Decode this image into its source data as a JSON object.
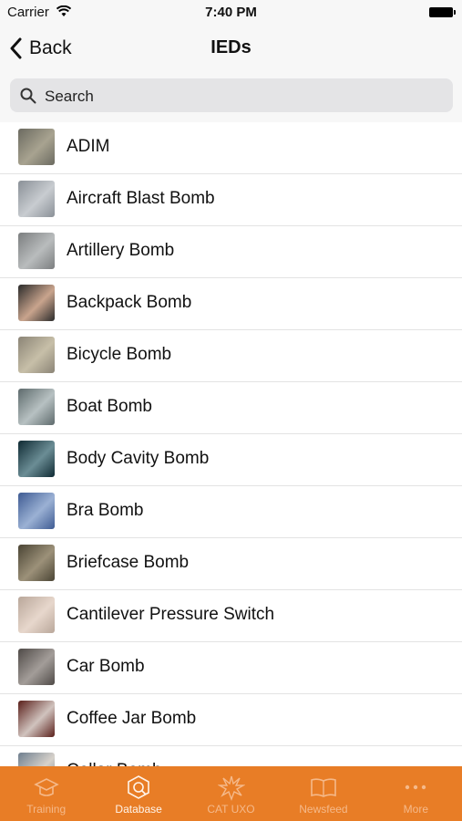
{
  "status": {
    "carrier": "Carrier",
    "time": "7:40 PM"
  },
  "nav": {
    "back_label": "Back",
    "title": "IEDs"
  },
  "search": {
    "placeholder": "Search",
    "value": ""
  },
  "items": [
    {
      "label": "ADIM",
      "thumb": [
        "#6b6a60",
        "#a8a390"
      ]
    },
    {
      "label": "Aircraft Blast Bomb",
      "thumb": [
        "#8a9097",
        "#c8ccd0"
      ]
    },
    {
      "label": "Artillery Bomb",
      "thumb": [
        "#7b7e7f",
        "#b9bcbd"
      ]
    },
    {
      "label": "Backpack Bomb",
      "thumb": [
        "#2a2a2a",
        "#c9a48d"
      ]
    },
    {
      "label": "Bicycle Bomb",
      "thumb": [
        "#8b8476",
        "#c7bfa8"
      ]
    },
    {
      "label": "Boat Bomb",
      "thumb": [
        "#5e6a6c",
        "#b7c1c2"
      ]
    },
    {
      "label": "Body Cavity Bomb",
      "thumb": [
        "#0f2a33",
        "#6b8d95"
      ]
    },
    {
      "label": "Bra Bomb",
      "thumb": [
        "#3e5b93",
        "#9bb1d4"
      ]
    },
    {
      "label": "Briefcase Bomb",
      "thumb": [
        "#4a4434",
        "#9c9179"
      ]
    },
    {
      "label": "Cantilever Pressure Switch",
      "thumb": [
        "#b9a79a",
        "#e7d7cc"
      ]
    },
    {
      "label": "Car Bomb",
      "thumb": [
        "#4f4a47",
        "#a39d99"
      ]
    },
    {
      "label": "Coffee Jar Bomb",
      "thumb": [
        "#5a1f1a",
        "#d0c3be"
      ]
    },
    {
      "label": "Collar Bomb",
      "thumb": [
        "#6f7f8f",
        "#d7d2cb"
      ]
    }
  ],
  "tabs": [
    {
      "label": "Training",
      "icon": "graduation-cap-icon",
      "active": false
    },
    {
      "label": "Database",
      "icon": "database-icon",
      "active": true
    },
    {
      "label": "CAT UXO",
      "icon": "explosion-icon",
      "active": false
    },
    {
      "label": "Newsfeed",
      "icon": "book-icon",
      "active": false
    },
    {
      "label": "More",
      "icon": "more-dots-icon",
      "active": false
    }
  ],
  "colors": {
    "accent": "#e87d26",
    "bar_bg": "#f7f7f7",
    "search_bg": "#e4e4e6"
  }
}
